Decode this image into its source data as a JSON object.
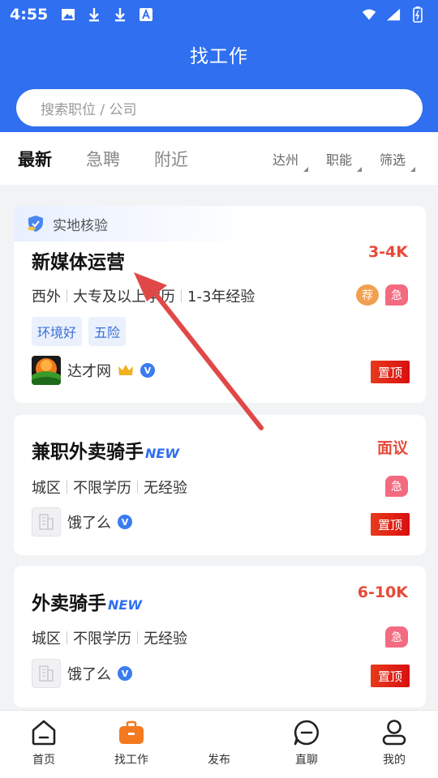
{
  "status_bar": {
    "time": "4:55"
  },
  "header": {
    "title": "找工作"
  },
  "search": {
    "placeholder": "搜索职位 / 公司"
  },
  "tabs": [
    {
      "label": "最新",
      "active": true
    },
    {
      "label": "急聘",
      "active": false
    },
    {
      "label": "附近",
      "active": false
    }
  ],
  "filters": [
    {
      "label": "达州"
    },
    {
      "label": "职能"
    },
    {
      "label": "筛选"
    }
  ],
  "jobs": [
    {
      "verify_label": "实地核验",
      "title": "新媒体运营",
      "new_label": "",
      "salary": "3-4K",
      "meta": [
        "西外",
        "大专及以上学历",
        "1-3年经验"
      ],
      "tags": [
        "环境好",
        "五险"
      ],
      "badges": [
        "荐",
        "急"
      ],
      "company": "达才网",
      "pin": "置顶"
    },
    {
      "title": "兼职外卖骑手",
      "new_label": "NEW",
      "salary": "面议",
      "meta": [
        "城区",
        "不限学历",
        "无经验"
      ],
      "badges": [
        "急"
      ],
      "company": "饿了么",
      "pin": "置顶"
    },
    {
      "title": "外卖骑手",
      "new_label": "NEW",
      "salary": "6-10K",
      "meta": [
        "城区",
        "不限学历",
        "无经验"
      ],
      "badges": [
        "急"
      ],
      "company": "饿了么",
      "pin": "置顶"
    }
  ],
  "bottom_nav": [
    {
      "label": "首页",
      "icon": "home-icon"
    },
    {
      "label": "找工作",
      "icon": "briefcase-icon",
      "active": true
    },
    {
      "label": "发布",
      "icon": "plus-icon"
    },
    {
      "label": "直聊",
      "icon": "chat-icon"
    },
    {
      "label": "我的",
      "icon": "user-icon"
    }
  ],
  "colors": {
    "primary": "#2f6ff0",
    "salary": "#e64a3a",
    "urgent": "#f36b80",
    "recommend": "#f0a050",
    "pin": "#e02a16",
    "annotation_arrow": "#e04848"
  }
}
